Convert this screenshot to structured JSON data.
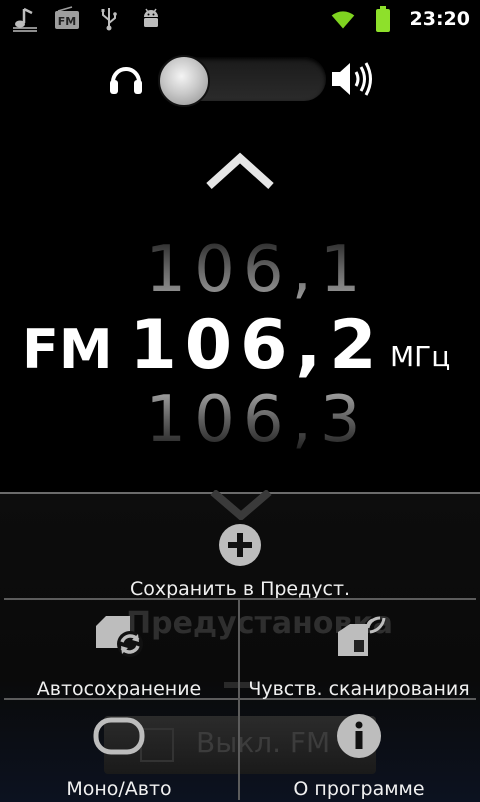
{
  "status_bar": {
    "left_icons": [
      "music-note-icon",
      "fm-radio-icon",
      "usb-icon",
      "android-debug-icon"
    ],
    "right_icons": [
      "wifi-icon",
      "battery-icon"
    ],
    "time": "23:20",
    "colors": {
      "wifi": "#7fd320",
      "battery": "#8ee02b"
    }
  },
  "audio_route": {
    "left_icon": "headphones-icon",
    "right_icon": "speaker-icon",
    "selected": "headphones"
  },
  "tuner": {
    "band": "FM",
    "prev_frequency": "106,1",
    "current_frequency": "106,2",
    "next_frequency": "106,3",
    "unit": "МГц"
  },
  "menu": {
    "background_preset_label": "Предустановка",
    "background_power_label": "Выкл. FM",
    "items": [
      {
        "label": "Сохранить в Предуст.",
        "icon": "add-circle-icon"
      },
      {
        "label": "Автосохранение",
        "icon": "autosave-refresh-icon"
      },
      {
        "label": "Чувств. сканирования",
        "icon": "scan-sensitivity-icon"
      },
      {
        "label": "Моно/Авто",
        "icon": "mono-auto-icon"
      },
      {
        "label": "О программе",
        "icon": "info-icon"
      }
    ]
  }
}
